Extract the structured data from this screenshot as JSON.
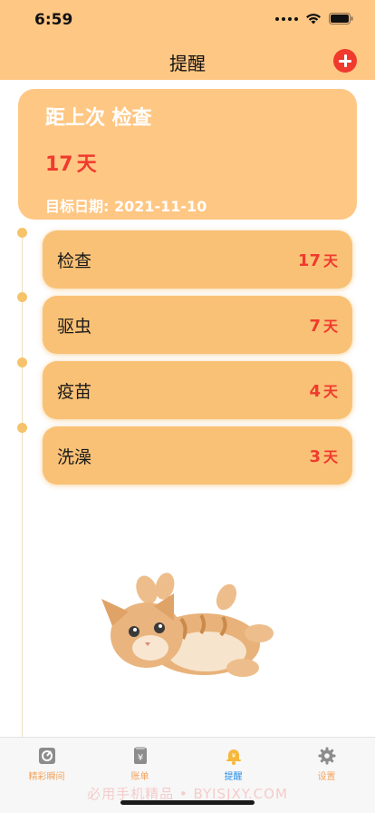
{
  "status": {
    "time": "6:59"
  },
  "nav": {
    "title": "提醒"
  },
  "summary": {
    "heading": "距上次 检查",
    "days": "17",
    "days_unit": "天",
    "target_date": "目标日期: 2021-11-10"
  },
  "reminders": [
    {
      "label": "检查",
      "days": "17",
      "unit": "天"
    },
    {
      "label": "驱虫",
      "days": "7",
      "unit": "天"
    },
    {
      "label": "疫苗",
      "days": "4",
      "unit": "天"
    },
    {
      "label": "洗澡",
      "days": "3",
      "unit": "天"
    }
  ],
  "tabbar": {
    "items": [
      {
        "label": "精彩瞬间",
        "icon": "camera-icon"
      },
      {
        "label": "账单",
        "icon": "bill-icon"
      },
      {
        "label": "提醒",
        "icon": "bell-icon",
        "active": true
      },
      {
        "label": "设置",
        "icon": "gear-icon"
      }
    ]
  },
  "watermark": "必用手机精品 • BYISJXY.COM",
  "colors": {
    "accent": "#FFC784",
    "card": "#F9C176",
    "danger": "#F03A2E",
    "tab_active": "#2B8FE8",
    "tab_inactive": "#F5A35C"
  }
}
